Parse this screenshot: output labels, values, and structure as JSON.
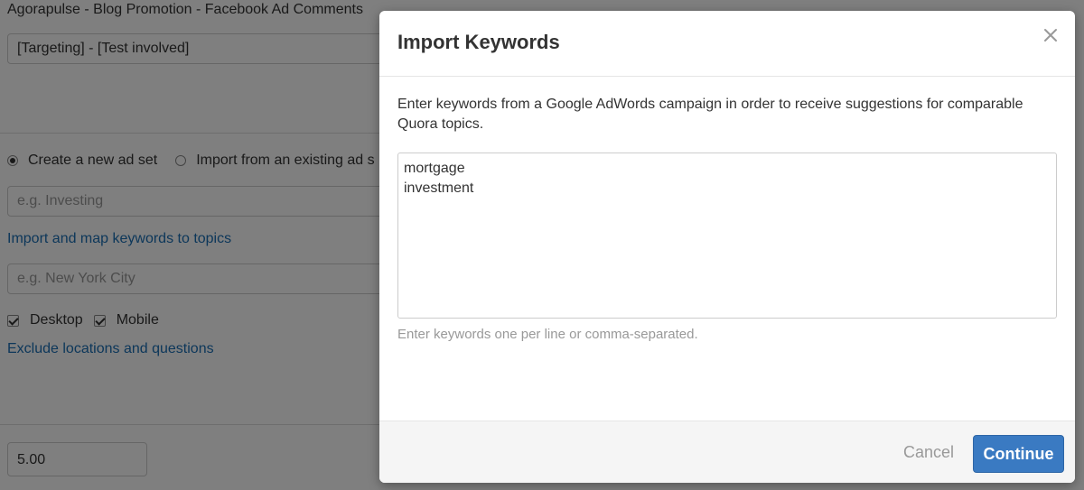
{
  "background": {
    "campaign_title": "Agorapulse - Blog Promotion - Facebook Ad Comments",
    "campaign_select_value": "[Targeting] - [Test involved]",
    "adset_options": [
      {
        "label": "Create a new ad set",
        "checked": true
      },
      {
        "label": "Import from an existing ad s",
        "checked": false
      }
    ],
    "topics_placeholder": "e.g. Investing",
    "import_link": "Import and map keywords to topics",
    "location_placeholder": "e.g. New York City",
    "devices": [
      {
        "label": "Desktop",
        "checked": true
      },
      {
        "label": "Mobile",
        "checked": true
      }
    ],
    "exclude_link": "Exclude locations and questions",
    "budget_value": "5.00"
  },
  "modal": {
    "title": "Import Keywords",
    "description": "Enter keywords from a Google AdWords campaign in order to receive suggestions for comparable Quora topics.",
    "textarea_value": "mortgage\ninvestment",
    "help_text": "Enter keywords one per line or comma-separated.",
    "cancel_label": "Cancel",
    "continue_label": "Continue"
  },
  "icons": {
    "close": "close-icon"
  },
  "colors": {
    "primary": "#3a7ac2",
    "link": "#1a6fb5",
    "overlay": "rgba(0,0,0,0.5)"
  }
}
